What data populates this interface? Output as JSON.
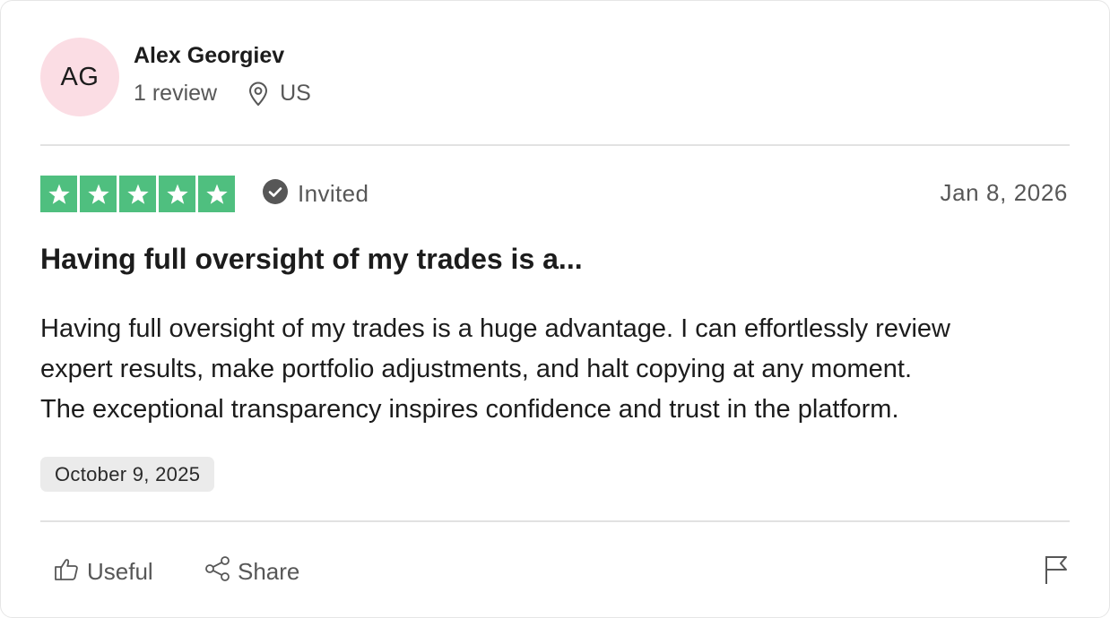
{
  "reviewer": {
    "initials": "AG",
    "name": "Alex Georgiev",
    "review_count": "1 review",
    "country": "US",
    "avatar_color": "#fbdde4"
  },
  "rating": {
    "stars": 5,
    "max_stars": 5,
    "star_color": "#4fbf7f",
    "invited_label": "Invited",
    "invited_icon": "check-circle-icon",
    "date": "Jan 8, 2026"
  },
  "review": {
    "title": "Having full oversight of my trades is a...",
    "body_lines": [
      "Having full oversight of my trades is a huge advantage. I can effortlessly review",
      "expert results, make portfolio adjustments, and halt copying at any moment.",
      "The exceptional transparency inspires confidence and trust in the platform."
    ],
    "experience_date": "October 9, 2025"
  },
  "actions": {
    "useful_label": "Useful",
    "useful_icon": "thumbs-up-icon",
    "share_label": "Share",
    "share_icon": "share-icon",
    "report_icon": "flag-icon"
  }
}
